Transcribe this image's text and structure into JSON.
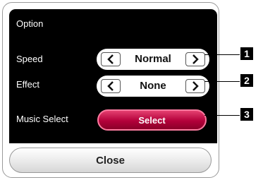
{
  "dialog": {
    "title": "Option"
  },
  "speed": {
    "label": "Speed",
    "value": "Normal"
  },
  "effect": {
    "label": "Effect",
    "value": "None"
  },
  "music_select": {
    "label": "Music Select",
    "button_label": "Select"
  },
  "close_label": "Close",
  "callouts": [
    "1",
    "2",
    "3"
  ],
  "colors": {
    "panel": "#000000",
    "select_button": "#c4003f",
    "select_border": "#ff7aa0"
  },
  "icons": {
    "prev": "chevron-left-icon",
    "next": "chevron-right-icon"
  }
}
